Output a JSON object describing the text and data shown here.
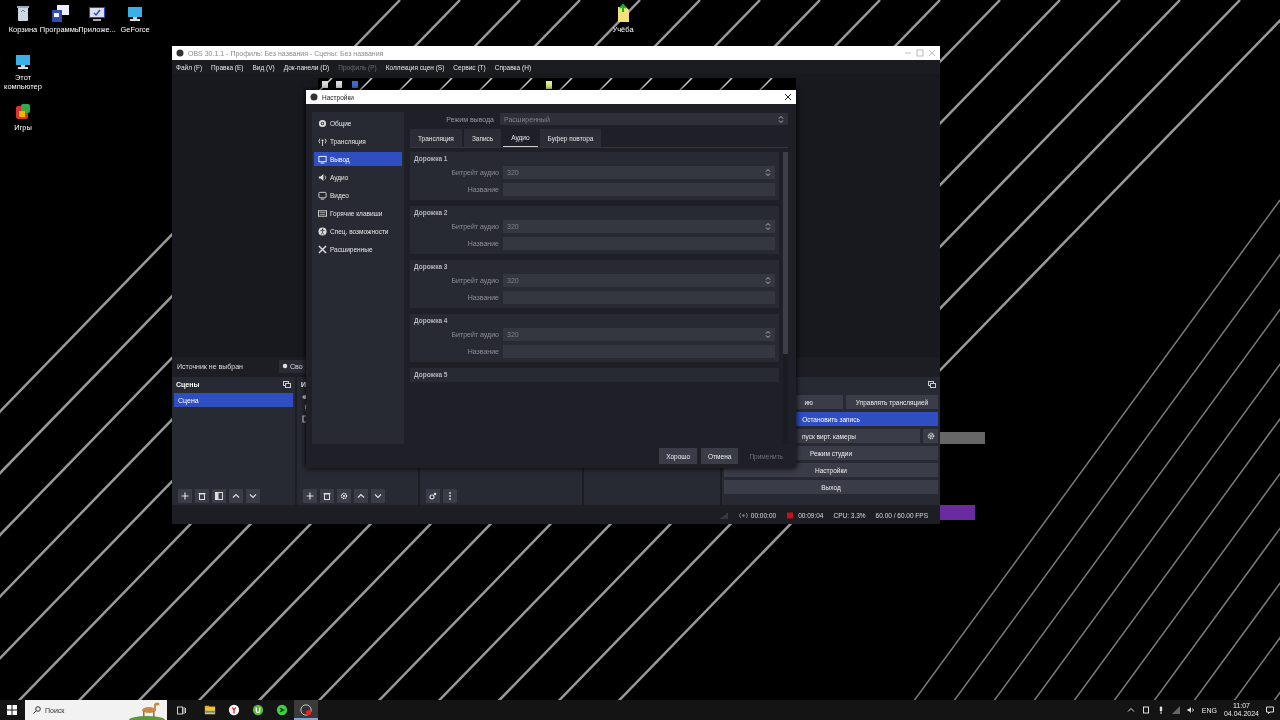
{
  "desktop_icons": [
    {
      "label": "Корзина",
      "kind": "bin"
    },
    {
      "label": "Программы",
      "kind": "programs"
    },
    {
      "label": "Приложе...",
      "kind": "apps"
    },
    {
      "label": "GeForce",
      "kind": "monitor"
    },
    {
      "label": "Этот компьютер",
      "kind": "monitor"
    },
    {
      "label": "Игры",
      "kind": "games"
    },
    {
      "label": "Учёба",
      "kind": "file"
    }
  ],
  "obs": {
    "title": "OBS 30.1.1 - Профиль: Без названия - Сцены: Без названия",
    "menu": [
      {
        "label": "Файл (F)",
        "disabled": false
      },
      {
        "label": "Правка (E)",
        "disabled": false
      },
      {
        "label": "Вид (V)",
        "disabled": false
      },
      {
        "label": "Док-панели (D)",
        "disabled": false
      },
      {
        "label": "Профиль (P)",
        "disabled": true
      },
      {
        "label": "Коллекция сцен (S)",
        "disabled": false
      },
      {
        "label": "Сервис (T)",
        "disabled": false
      },
      {
        "label": "Справка (H)",
        "disabled": false
      }
    ],
    "source_label": "Источник не выбран",
    "properties_button": "Сво",
    "scenes": {
      "title": "Сцены",
      "items": [
        {
          "label": "Сцена",
          "selected": true
        }
      ]
    },
    "sources": {
      "title": "И"
    },
    "controls": [
      [
        {
          "label": "ию",
          "active": false
        },
        {
          "label": "Управлять трансляцией",
          "active": false
        }
      ],
      [
        {
          "label": "Остановить запись",
          "active": true
        }
      ],
      [
        {
          "label": "пуск вирт. камеры",
          "active": false
        }
      ],
      [
        {
          "label": "Режим студии",
          "active": false
        }
      ],
      [
        {
          "label": "Настройки",
          "active": false
        }
      ],
      [
        {
          "label": "Выход",
          "active": false
        }
      ]
    ],
    "status": {
      "stream_time": "00:00:00",
      "record_time": "00:09:04",
      "cpu": "CPU: 3.3%",
      "fps": "60.00 / 60.00 FPS"
    }
  },
  "settings": {
    "title": "Настройки",
    "sidebar": [
      {
        "label": "Общие",
        "kind": "general",
        "selected": false
      },
      {
        "label": "Трансляция",
        "kind": "stream",
        "selected": false
      },
      {
        "label": "Вывод",
        "kind": "output",
        "selected": true
      },
      {
        "label": "Аудио",
        "kind": "audio",
        "selected": false
      },
      {
        "label": "Видео",
        "kind": "video",
        "selected": false
      },
      {
        "label": "Горячие клавиши",
        "kind": "hotkeys",
        "selected": false
      },
      {
        "label": "Спец. возможности",
        "kind": "accessibility",
        "selected": false
      },
      {
        "label": "Расширенные",
        "kind": "advanced",
        "selected": false
      }
    ],
    "output_mode_label": "Режим вывода",
    "output_mode": "Расширенный",
    "tabs": [
      {
        "label": "Трансляция",
        "selected": false
      },
      {
        "label": "Запись",
        "selected": false
      },
      {
        "label": "Аудио",
        "selected": true
      },
      {
        "label": "Буфер повтора",
        "selected": false
      }
    ],
    "tracks": [
      {
        "title": "Дорожка 1",
        "bitrate_label": "Битрейт аудио",
        "bitrate": "320",
        "name_label": "Название"
      },
      {
        "title": "Дорожка 2",
        "bitrate_label": "Битрейт аудио",
        "bitrate": "320",
        "name_label": "Название"
      },
      {
        "title": "Дорожка 3",
        "bitrate_label": "Битрейт аудио",
        "bitrate": "320",
        "name_label": "Название"
      },
      {
        "title": "Дорожка 4",
        "bitrate_label": "Битрейт аудио",
        "bitrate": "320",
        "name_label": "Название"
      },
      {
        "title": "Дорожка 5"
      }
    ],
    "buttons": [
      {
        "label": "Хорошо",
        "disabled": false
      },
      {
        "label": "Отмена",
        "disabled": false
      },
      {
        "label": "Применить",
        "disabled": true
      }
    ]
  },
  "taskbar": {
    "search_placeholder": "Поиск",
    "apps": [
      {
        "kind": "explorer",
        "selected": false
      },
      {
        "kind": "browser",
        "selected": false
      },
      {
        "kind": "torrent",
        "selected": false
      },
      {
        "kind": "share",
        "selected": false
      },
      {
        "kind": "obs",
        "selected": true
      }
    ],
    "language": "ENG",
    "time": "11:07",
    "date": "04.04.2024"
  }
}
